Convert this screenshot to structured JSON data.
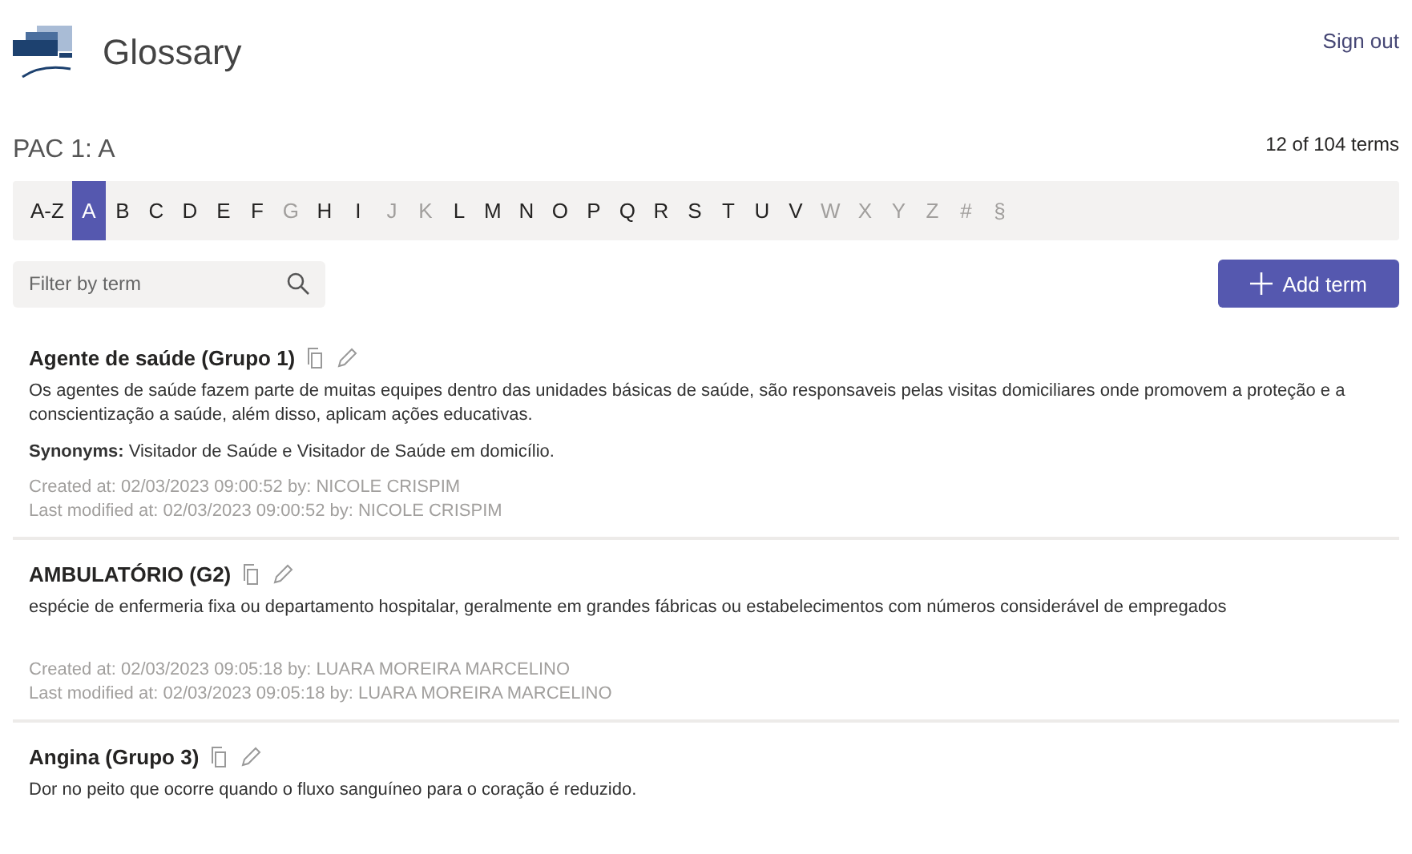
{
  "header": {
    "title": "Glossary",
    "sign_out": "Sign out"
  },
  "glossary_name": "PAC 1: A",
  "count": "12 of 104 terms",
  "letters": [
    {
      "label": "A-Z",
      "selected": false,
      "disabled": false
    },
    {
      "label": "A",
      "selected": true,
      "disabled": false
    },
    {
      "label": "B",
      "selected": false,
      "disabled": false
    },
    {
      "label": "C",
      "selected": false,
      "disabled": false
    },
    {
      "label": "D",
      "selected": false,
      "disabled": false
    },
    {
      "label": "E",
      "selected": false,
      "disabled": false
    },
    {
      "label": "F",
      "selected": false,
      "disabled": false
    },
    {
      "label": "G",
      "selected": false,
      "disabled": true
    },
    {
      "label": "H",
      "selected": false,
      "disabled": false
    },
    {
      "label": "I",
      "selected": false,
      "disabled": false
    },
    {
      "label": "J",
      "selected": false,
      "disabled": true
    },
    {
      "label": "K",
      "selected": false,
      "disabled": true
    },
    {
      "label": "L",
      "selected": false,
      "disabled": false
    },
    {
      "label": "M",
      "selected": false,
      "disabled": false
    },
    {
      "label": "N",
      "selected": false,
      "disabled": false
    },
    {
      "label": "O",
      "selected": false,
      "disabled": false
    },
    {
      "label": "P",
      "selected": false,
      "disabled": false
    },
    {
      "label": "Q",
      "selected": false,
      "disabled": false
    },
    {
      "label": "R",
      "selected": false,
      "disabled": false
    },
    {
      "label": "S",
      "selected": false,
      "disabled": false
    },
    {
      "label": "T",
      "selected": false,
      "disabled": false
    },
    {
      "label": "U",
      "selected": false,
      "disabled": false
    },
    {
      "label": "V",
      "selected": false,
      "disabled": false
    },
    {
      "label": "W",
      "selected": false,
      "disabled": true
    },
    {
      "label": "X",
      "selected": false,
      "disabled": true
    },
    {
      "label": "Y",
      "selected": false,
      "disabled": true
    },
    {
      "label": "Z",
      "selected": false,
      "disabled": true
    },
    {
      "label": "#",
      "selected": false,
      "disabled": true
    },
    {
      "label": "§",
      "selected": false,
      "disabled": true
    }
  ],
  "search": {
    "placeholder": "Filter by term"
  },
  "add_button": "Add term",
  "terms": [
    {
      "name": "Agente de saúde (Grupo 1)",
      "description": "Os agentes de saúde fazem parte de muitas equipes dentro das unidades básicas de saúde, são responsaveis pelas visitas domiciliares onde promovem a proteção e a conscientização a saúde, além disso, aplicam ações educativas.",
      "synonyms": "**Synonyms:** Visitador de Saúde e Visitador de Saúde em domicílio.",
      "created": "Created at: 02/03/2023 09:00:52 by: NICOLE CRISPIM",
      "modified": "Last modified at: 02/03/2023 09:00:52 by: NICOLE CRISPIM"
    },
    {
      "name": "AMBULATÓRIO (G2)",
      "description": "espécie de enfermeria fixa ou departamento hospitalar, geralmente em grandes fábricas ou estabelecimentos com números considerável de empregados",
      "created": "Created at: 02/03/2023 09:05:18 by: LUARA MOREIRA MARCELINO",
      "modified": "Last modified at: 02/03/2023 09:05:18 by: LUARA MOREIRA MARCELINO"
    },
    {
      "name": "Angina (Grupo 3)",
      "description": "Dor no peito que ocorre quando o fluxo sanguíneo para o coração é reduzido."
    }
  ]
}
